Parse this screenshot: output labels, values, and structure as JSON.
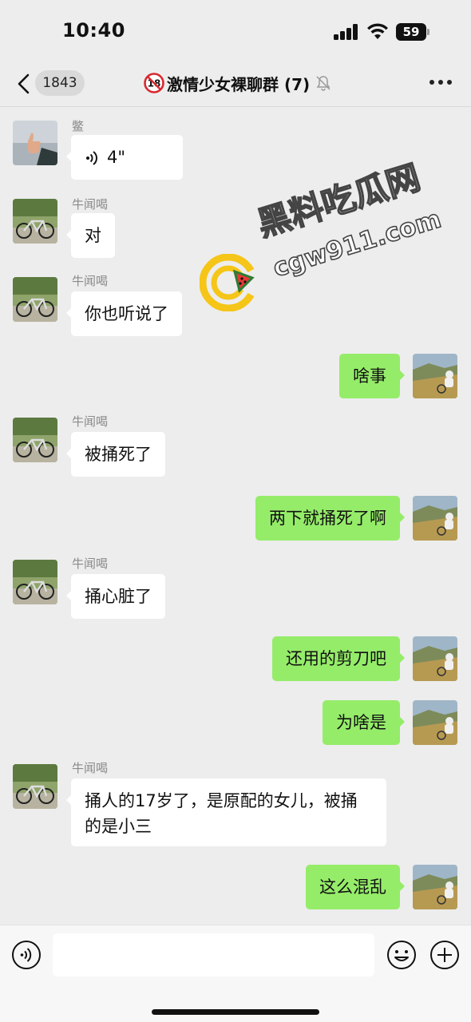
{
  "status_bar": {
    "time": "10:40",
    "battery": "59"
  },
  "nav": {
    "unread_count": "1843",
    "title": "激情少女裸聊群 (7)",
    "back_icon": "chevron-left-icon",
    "title_prefix_icon": "age-18-prohibited-icon",
    "muted_icon": "bell-slash-icon",
    "more_icon": "ellipsis-icon"
  },
  "messages": [
    {
      "side": "in",
      "sender": "鳖",
      "text": "4\"",
      "type": "voice",
      "avatar": "thumbs-up-avatar"
    },
    {
      "side": "in",
      "sender": "牛闻喝",
      "text": "对",
      "avatar": "bicycle-avatar"
    },
    {
      "side": "in",
      "sender": "牛闻喝",
      "text": "你也听说了",
      "avatar": "bicycle-avatar"
    },
    {
      "side": "out",
      "text": "啥事",
      "avatar": "hillside-avatar"
    },
    {
      "side": "in",
      "sender": "牛闻喝",
      "text": "被捅死了",
      "avatar": "bicycle-avatar"
    },
    {
      "side": "out",
      "text": "两下就捅死了啊",
      "avatar": "hillside-avatar"
    },
    {
      "side": "in",
      "sender": "牛闻喝",
      "text": "捅心脏了",
      "avatar": "bicycle-avatar"
    },
    {
      "side": "out",
      "text": "还用的剪刀吧",
      "avatar": "hillside-avatar"
    },
    {
      "side": "out",
      "text": "为啥是",
      "avatar": "hillside-avatar"
    },
    {
      "side": "in",
      "sender": "牛闻喝",
      "text": "捅人的17岁了，是原配的女儿，被捅的是小三",
      "avatar": "bicycle-avatar"
    },
    {
      "side": "out",
      "text": "这么混乱",
      "avatar": "hillside-avatar"
    }
  ],
  "watermark": {
    "title": "黑料吃瓜网",
    "domain": "cgw911.com"
  },
  "input_bar": {
    "value": "",
    "placeholder": ""
  },
  "colors": {
    "background": "#ededed",
    "outgoing_bubble": "#95ec69",
    "incoming_bubble": "#ffffff",
    "input_bar": "#f7f7f7"
  }
}
